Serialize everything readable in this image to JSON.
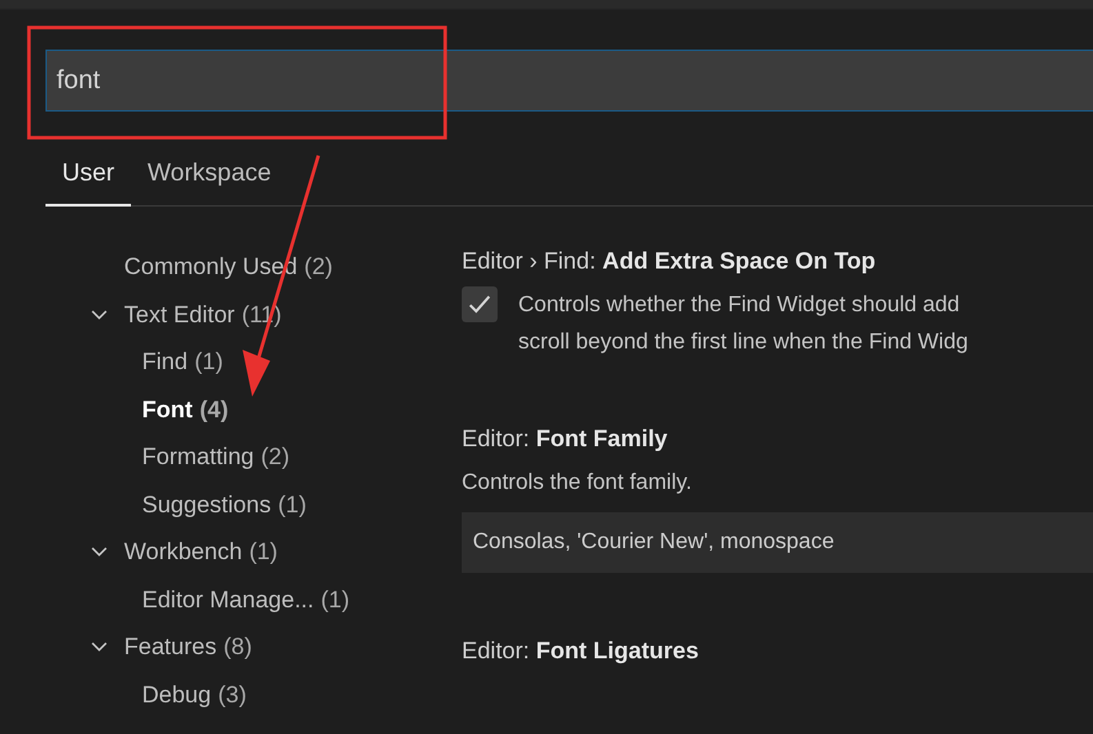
{
  "search": {
    "value": "font"
  },
  "tabs": [
    {
      "label": "User",
      "selected": true
    },
    {
      "label": "Workspace",
      "selected": false
    }
  ],
  "toc": [
    {
      "kind": "item",
      "label": "Commonly Used",
      "count": "(2)",
      "selected": false
    },
    {
      "kind": "section",
      "label": "Text Editor",
      "count": "(11)",
      "expanded": true,
      "children": [
        {
          "label": "Find",
          "count": "(1)",
          "selected": false
        },
        {
          "label": "Font",
          "count": "(4)",
          "selected": true
        },
        {
          "label": "Formatting",
          "count": "(2)",
          "selected": false
        },
        {
          "label": "Suggestions",
          "count": "(1)",
          "selected": false
        }
      ]
    },
    {
      "kind": "section",
      "label": "Workbench",
      "count": "(1)",
      "expanded": true,
      "children": [
        {
          "label": "Editor Manage...",
          "count": "(1)",
          "selected": false
        }
      ]
    },
    {
      "kind": "section",
      "label": "Features",
      "count": "(8)",
      "expanded": true,
      "children": [
        {
          "label": "Debug",
          "count": "(3)",
          "selected": false
        }
      ]
    }
  ],
  "settings": [
    {
      "kind": "checkbox",
      "category": "Editor › Find:",
      "title": "Add Extra Space On Top",
      "checked": true,
      "description_lines": [
        "Controls whether the Find Widget should add",
        "scroll beyond the first line when the Find Widg"
      ]
    },
    {
      "kind": "text",
      "category": "Editor:",
      "title": "Font Family",
      "description": "Controls the font family.",
      "value": "Consolas, 'Courier New', monospace"
    },
    {
      "kind": "heading",
      "category": "Editor:",
      "title": "Font Ligatures"
    }
  ]
}
